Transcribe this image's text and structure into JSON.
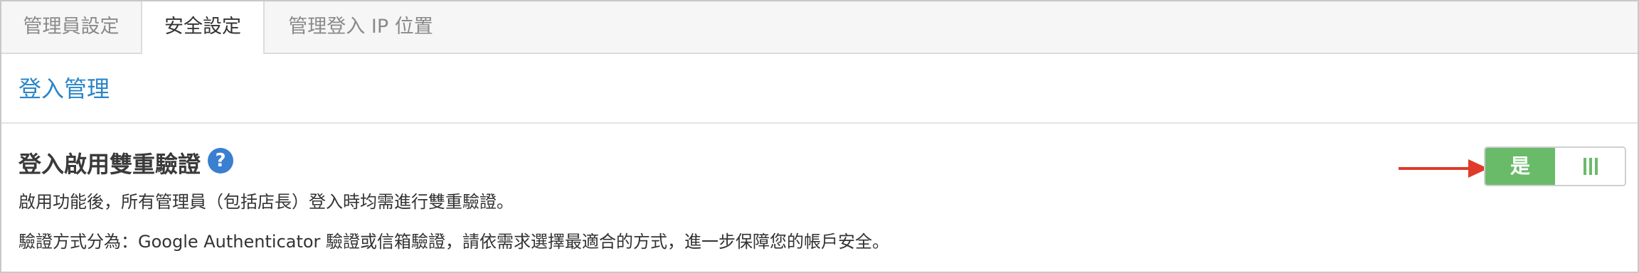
{
  "tabs": [
    {
      "label": "管理員設定",
      "active": false
    },
    {
      "label": "安全設定",
      "active": true
    },
    {
      "label": "管理登入 IP 位置",
      "active": false
    }
  ],
  "section": {
    "title": "登入管理"
  },
  "setting": {
    "title": "登入啟用雙重驗證",
    "help_icon_glyph": "?",
    "description_line1": "啟用功能後，所有管理員（包括店長）登入時均需進行雙重驗證。",
    "description_line2": "驗證方式分為：Google Authenticator 驗證或信箱驗證，請依需求選擇最適合的方式，進一步保障您的帳戶安全。",
    "toggle": {
      "on_label": "是",
      "state": "on"
    }
  },
  "colors": {
    "link_blue": "#2a86c8",
    "toggle_green": "#6abb69",
    "help_blue": "#3a7fd0",
    "arrow_red": "#e03a2a"
  },
  "icons": {
    "help": "question-circle-icon",
    "arrow": "arrow-right-icon",
    "grip": "grip-lines-icon"
  }
}
